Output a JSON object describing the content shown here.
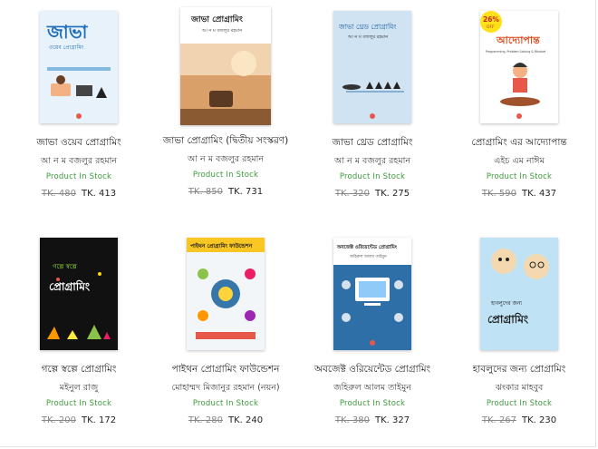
{
  "books": [
    {
      "title": "জাভা ওয়েব প্রোগ্রামিং",
      "author": "আ ন ম বজলুর রহমান",
      "stock": "Product In Stock",
      "old_price": "TK. 480",
      "new_price": "TK. 413",
      "cover_text": "জাভা",
      "cover_subtext": "ওয়েব প্রোগ্রামিং",
      "cover_color": "#1d7fc4"
    },
    {
      "title": "জাভা প্রোগ্রামিং (দ্বিতীয় সংস্করণ)",
      "author": "আ ন ম বজলুর রহমান",
      "stock": "Product In Stock",
      "old_price": "TK. 850",
      "new_price": "TK. 731",
      "cover_text": "জাভা প্রোগ্রামিং",
      "cover_subtext": "আ ন ম বজলুর রহমান",
      "cover_color": "#c98b4a"
    },
    {
      "title": "জাভা থ্রেড প্রোগ্রামিং",
      "author": "আ ন ম বজলুর রহমান",
      "stock": "Product In Stock",
      "old_price": "TK. 320",
      "new_price": "TK. 275",
      "cover_text": "জাভা থ্রেড প্রোগ্রামিং",
      "cover_subtext": "আ ন ম বজলুর রহমান",
      "cover_color": "#cfe3f2"
    },
    {
      "title": "প্রোগ্রামিং এর আদ্যোপান্ত",
      "author": "এইচ এম নাঈম",
      "stock": "Product In Stock",
      "old_price": "TK. 590",
      "new_price": "TK. 437",
      "cover_text": "আদ্যোপান্ত",
      "cover_subtext": "Programming, Problem Solving & Mindset",
      "badge": "26%",
      "badge_sub": "OFF",
      "cover_color": "#ffffff"
    },
    {
      "title": "গল্পে স্বল্পে প্রোগ্রামিং",
      "author": "মইনুল রাজু",
      "stock": "Product In Stock",
      "old_price": "TK. 200",
      "new_price": "TK. 172",
      "cover_text": "প্রোগ্রামিং",
      "cover_subtext": "গল্পে স্বল্পে",
      "cover_color": "#111111"
    },
    {
      "title": "পাইথন প্রোগ্রামিং ফাউন্ডেশন",
      "author": "মোহাম্মদ মিজানুর রহমান (নয়ন)",
      "stock": "Product In Stock",
      "old_price": "TK. 280",
      "new_price": "TK. 240",
      "cover_text": "পাইথন প্রোগ্রামিং ফাউন্ডেশন",
      "cover_subtext": "",
      "cover_color": "#f3f6f8"
    },
    {
      "title": "অবজেক্ট ওরিয়েন্টেড প্রোগ্রামিং",
      "author": "জহিরুল আলম তাইমুন",
      "stock": "Product In Stock",
      "old_price": "TK. 380",
      "new_price": "TK. 327",
      "cover_text": "অবজেক্ট ওরিয়েন্টেড প্রোগ্রামিং",
      "cover_subtext": "জহিরুল আলম তাইমুন",
      "cover_color": "#2f6fa8"
    },
    {
      "title": "হাবলুদের জন্য প্রোগ্রামিং",
      "author": "ঝংকার মাহবুব",
      "stock": "Product In Stock",
      "old_price": "TK. 267",
      "new_price": "TK. 230",
      "cover_text": "প্রোগ্রামিং",
      "cover_subtext": "হাবলুদের জন্য",
      "cover_color": "#bfe3f5"
    }
  ]
}
